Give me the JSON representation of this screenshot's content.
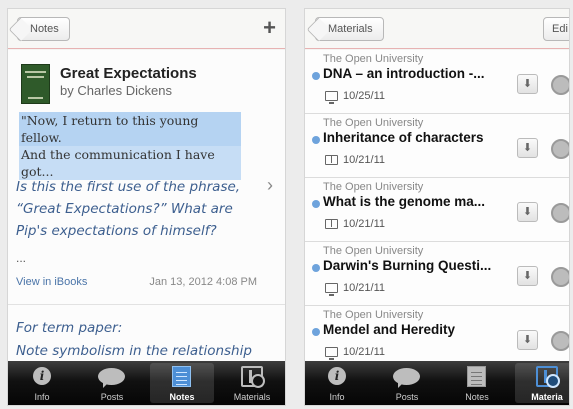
{
  "notes_screen": {
    "back_label": "Notes",
    "add_label": "+",
    "book": {
      "title": "Great Expectations",
      "author": "by Charles Dickens"
    },
    "highlight_lines": [
      "\"Now, I return to this young fellow.",
      "And the communication I have got..."
    ],
    "note_text": "Is this the first use of the phrase, “Great Expectations?” What are Pip's expectations of himself?",
    "ellipsis": "...",
    "view_link": "View in iBooks",
    "note_date": "Jan 13, 2012 4:08 PM",
    "note2_lines": [
      "For term paper:",
      "Note symbolism in the relationship"
    ],
    "tabs": [
      {
        "label": "Info",
        "icon": "info-icon"
      },
      {
        "label": "Posts",
        "icon": "speech-bubble-icon"
      },
      {
        "label": "Notes",
        "icon": "notes-icon"
      },
      {
        "label": "Materials",
        "icon": "materials-icon"
      }
    ],
    "active_tab": "Notes"
  },
  "materials_screen": {
    "back_label": "Materials",
    "edit_label": "Edi",
    "items": [
      {
        "publisher": "The Open University",
        "title": "DNA – an introduction -...",
        "type_icon": "monitor-icon",
        "date": "10/25/11"
      },
      {
        "publisher": "The Open University",
        "title": "Inheritance of characters",
        "type_icon": "book-icon",
        "date": "10/21/11"
      },
      {
        "publisher": "The Open University",
        "title": "What is the genome ma...",
        "type_icon": "book-icon",
        "date": "10/21/11"
      },
      {
        "publisher": "The Open University",
        "title": "Darwin's Burning Questi...",
        "type_icon": "monitor-icon",
        "date": "10/21/11"
      },
      {
        "publisher": "The Open University",
        "title": "Mendel and Heredity",
        "type_icon": "monitor-icon",
        "date": "10/21/11"
      }
    ],
    "download_glyph": "⬇",
    "tabs": [
      {
        "label": "Info",
        "icon": "info-icon"
      },
      {
        "label": "Posts",
        "icon": "speech-bubble-icon"
      },
      {
        "label": "Notes",
        "icon": "notes-icon"
      },
      {
        "label": "Materia",
        "icon": "materials-icon"
      }
    ],
    "active_tab": "Materia"
  },
  "colors": {
    "accent_blue": "#4d8fd6",
    "unread_dot": "#6ea3dc",
    "handwriting_blue": "#3d5f8f",
    "highlight": "#b5d3f2"
  }
}
